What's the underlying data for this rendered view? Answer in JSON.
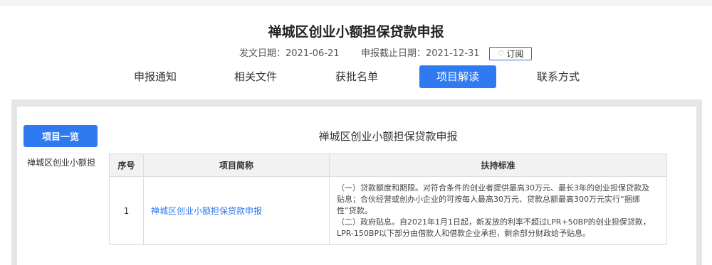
{
  "page": {
    "title": "禅城区创业小额担保贷款申报"
  },
  "meta": {
    "publish_label": "发文日期：2021-06-21",
    "deadline_label": "申报截止日期：2021-12-31",
    "subscribe_label": "订阅",
    "subscribe_icon": "heart-outline-icon"
  },
  "tabs": [
    {
      "label": "申报通知",
      "active": false
    },
    {
      "label": "相关文件",
      "active": false
    },
    {
      "label": "获批名单",
      "active": false
    },
    {
      "label": "项目解读",
      "active": true
    },
    {
      "label": "联系方式",
      "active": false
    }
  ],
  "sidebar": {
    "header_label": "项目一览",
    "items": [
      {
        "label": "禅城区创业小额担"
      }
    ]
  },
  "main": {
    "section_title": "禅城区创业小额担保贷款申报",
    "table": {
      "headers": [
        "序号",
        "项目简称",
        "扶持标准"
      ],
      "rows": [
        {
          "no": "1",
          "name": "禅城区创业小额担保贷款申报",
          "standard": [
            "（一）贷款额度和期限。对符合条件的创业者提供最高30万元、最长3年的创业担保贷款及",
            "贴息；合伙经营或创办小企业的可按每人最高30万元、贷款总额最高300万元实行“捆绑",
            "性”贷款。",
            "（二）政府贴息。自2021年1月1日起，新发放的利率不超过LPR+50BP的创业担保贷款，",
            "LPR-150BP以下部分由借款人和借款企业承担，剩余部分财政给予贴息。"
          ]
        }
      ]
    }
  },
  "colors": {
    "accent": "#2f7af0",
    "panel_bg": "#e6e6e6",
    "table_header_bg": "#f2f2f2"
  }
}
